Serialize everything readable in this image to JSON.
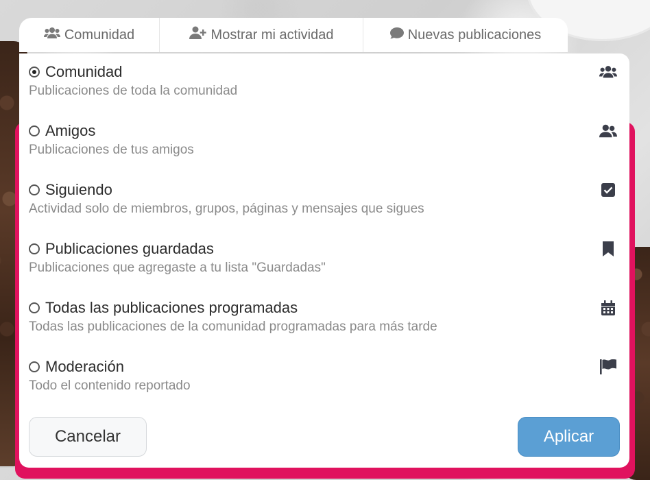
{
  "tabs": [
    {
      "icon": "users-icon",
      "label": "Comunidad"
    },
    {
      "icon": "user-plus-icon",
      "label": "Mostrar mi actividad"
    },
    {
      "icon": "comment-icon",
      "label": "Nuevas publicaciones"
    }
  ],
  "options": [
    {
      "title": "Comunidad",
      "desc": "Publicaciones de toda la comunidad",
      "icon": "users-icon",
      "checked": true
    },
    {
      "title": "Amigos",
      "desc": "Publicaciones de tus amigos",
      "icon": "user-friends-icon",
      "checked": false
    },
    {
      "title": "Siguiendo",
      "desc": "Actividad solo de miembros, grupos, páginas y mensajes que sigues",
      "icon": "check-square-icon",
      "checked": false
    },
    {
      "title": "Publicaciones guardadas",
      "desc": "Publicaciones que agregaste a tu lista \"Guardadas\"",
      "icon": "bookmark-icon",
      "checked": false
    },
    {
      "title": "Todas las publicaciones programadas",
      "desc": "Todas las publicaciones de la comunidad programadas para más tarde",
      "icon": "calendar-icon",
      "checked": false
    },
    {
      "title": "Moderación",
      "desc": "Todo el contenido reportado",
      "icon": "flag-icon",
      "checked": false
    }
  ],
  "buttons": {
    "cancel": "Cancelar",
    "apply": "Aplicar"
  },
  "colors": {
    "accent": "#5b9fd4",
    "frame": "#e0125e",
    "icon": "#3b3e4a"
  }
}
